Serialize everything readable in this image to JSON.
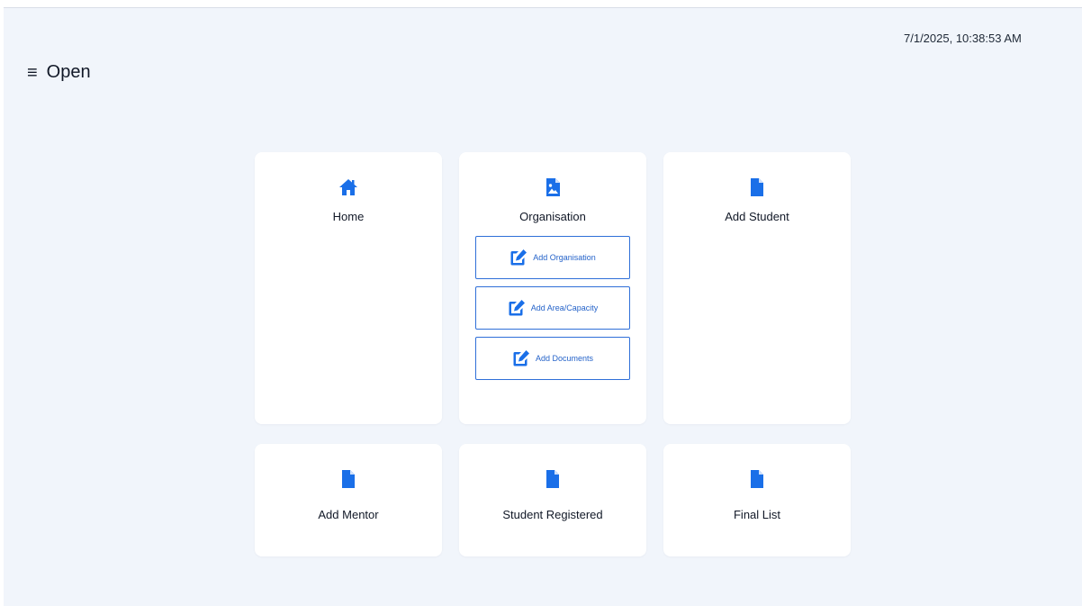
{
  "header": {
    "timestamp": "7/1/2025, 10:38:53 AM",
    "menu_label": "Open"
  },
  "cards": {
    "home": {
      "label": "Home",
      "icon": "home-icon"
    },
    "organisation": {
      "label": "Organisation",
      "icon": "image-file-icon",
      "sub_items": [
        {
          "label": "Add Organisation",
          "icon": "edit-icon"
        },
        {
          "label": "Add Area/Capacity",
          "icon": "edit-icon"
        },
        {
          "label": "Add Documents",
          "icon": "edit-icon"
        }
      ]
    },
    "add_student": {
      "label": "Add Student",
      "icon": "file-icon"
    },
    "add_mentor": {
      "label": "Add Mentor",
      "icon": "file-icon"
    },
    "student_registered": {
      "label": "Student Registered",
      "icon": "file-icon"
    },
    "final_list": {
      "label": "Final List",
      "icon": "file-icon"
    }
  },
  "colors": {
    "accent": "#1a6fe8",
    "background": "#f1f5fb",
    "card": "#ffffff",
    "button_border": "#2f6fd8"
  }
}
